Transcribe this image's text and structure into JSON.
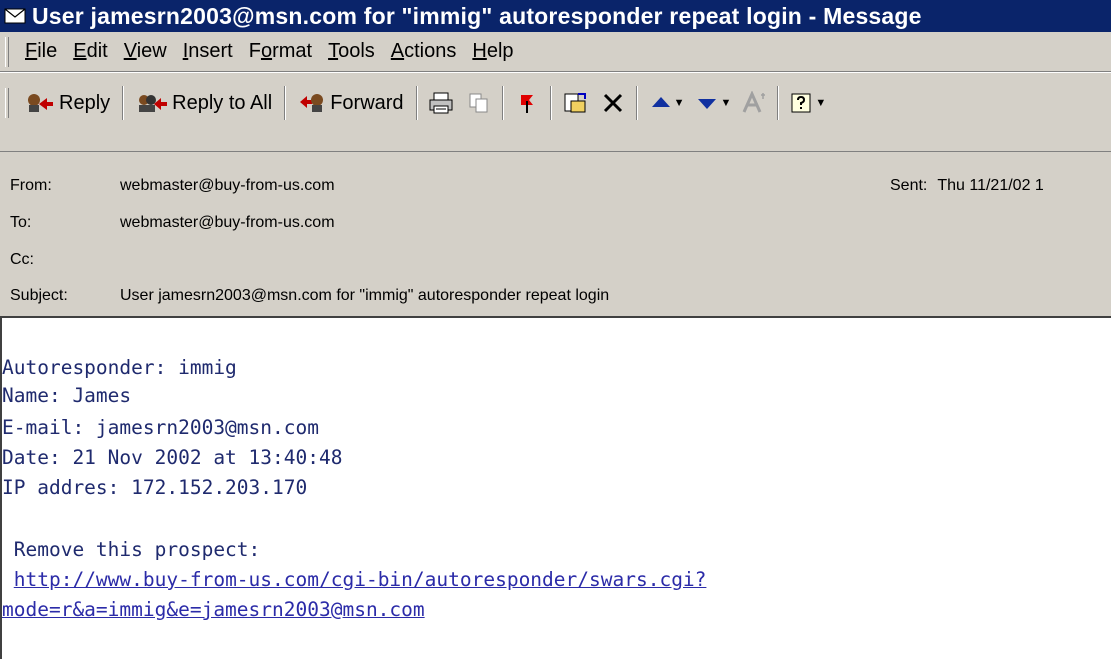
{
  "window": {
    "title": "User jamesrn2003@msn.com for \"immig\" autoresponder repeat login - Message"
  },
  "menu": [
    {
      "label": "File",
      "underline": "F",
      "rest": "ile"
    },
    {
      "label": "Edit",
      "underline": "E",
      "rest": "dit"
    },
    {
      "label": "View",
      "underline": "V",
      "rest": "iew"
    },
    {
      "label": "Insert",
      "underline": "I",
      "rest": "nsert"
    },
    {
      "label": "Format",
      "pre": "F",
      "underline": "o",
      "rest": "rmat"
    },
    {
      "label": "Tools",
      "underline": "T",
      "rest": "ools"
    },
    {
      "label": "Actions",
      "underline": "A",
      "rest": "ctions"
    },
    {
      "label": "Help",
      "underline": "H",
      "rest": "elp"
    }
  ],
  "toolbar": {
    "reply_label": "Reply",
    "reply_all_label": "Reply to All",
    "forward_label": "Forward"
  },
  "headers": {
    "from_label": "From:",
    "from_value": "webmaster@buy-from-us.com",
    "to_label": "To:",
    "to_value": "webmaster@buy-from-us.com",
    "cc_label": "Cc:",
    "cc_value": "",
    "subject_label": "Subject:",
    "subject_value": "User jamesrn2003@msn.com for \"immig\" autoresponder repeat login",
    "sent_label": "Sent:",
    "sent_value": "Thu 11/21/02 1"
  },
  "message": {
    "line1": "Autoresponder: immig",
    "line2": "Name: James",
    "line3": "E-mail: jamesrn2003@msn.com",
    "line4": "Date: 21 Nov 2002 at 13:40:48",
    "line5": "IP addres: 172.152.203.170",
    "remove_label": " Remove this prospect:",
    "link_part1": "http://www.buy-from-us.com/cgi-bin/autoresponder/swars.cgi?",
    "link_part2": "mode=r&a=immig&e=jamesrn2003@msn.com"
  }
}
